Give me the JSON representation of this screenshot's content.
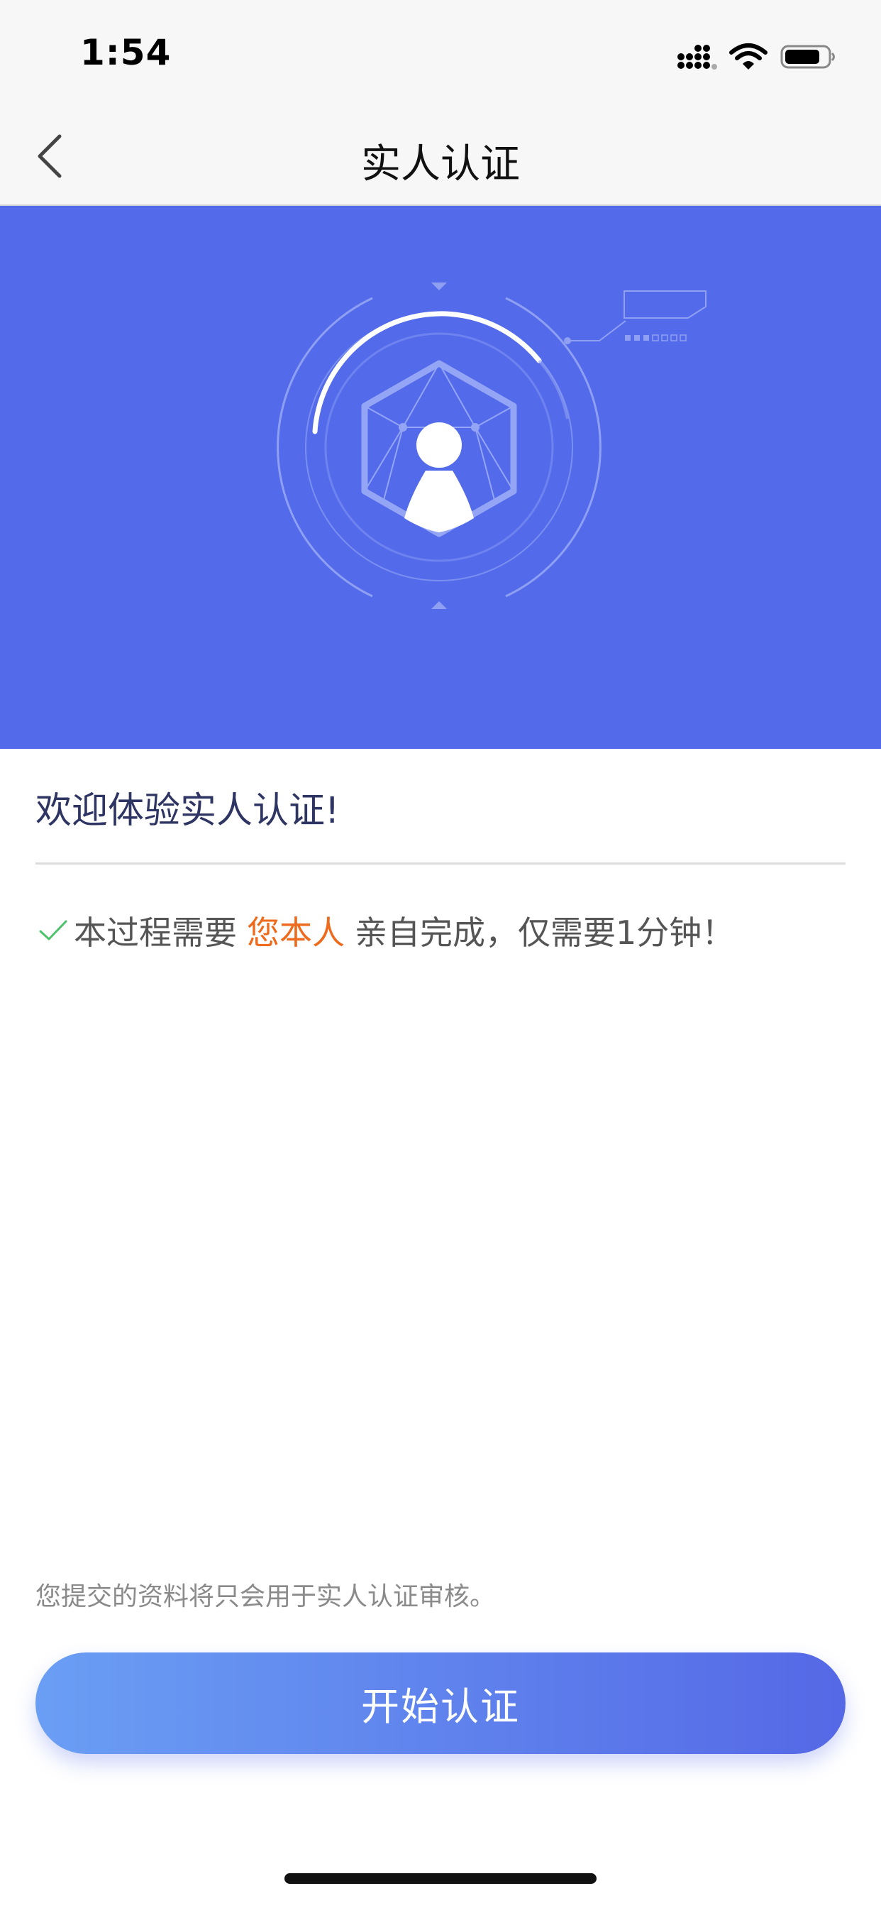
{
  "status_bar": {
    "time": "1:54",
    "icons": [
      "signal-icon",
      "wifi-icon",
      "battery-icon"
    ]
  },
  "nav": {
    "title": "实人认证",
    "back_icon": "chevron-left-icon"
  },
  "banner": {
    "background_color": "#536bea",
    "illustration": "face-verification-illustration"
  },
  "content": {
    "welcome": "欢迎体验实人认证!",
    "notice": {
      "prefix": "本过程需要",
      "highlight": "您本人",
      "suffix": "亲自完成，仅需要1分钟！",
      "highlight_color": "#ee6a1c",
      "check_color": "#4cc26a"
    },
    "privacy_note": "您提交的资料将只会用于实人认证审核。"
  },
  "actions": {
    "start_label": "开始认证"
  },
  "colors": {
    "accent": "#536bea",
    "button_gradient_start": "#6a9ef4",
    "button_gradient_end": "#5568e6"
  }
}
